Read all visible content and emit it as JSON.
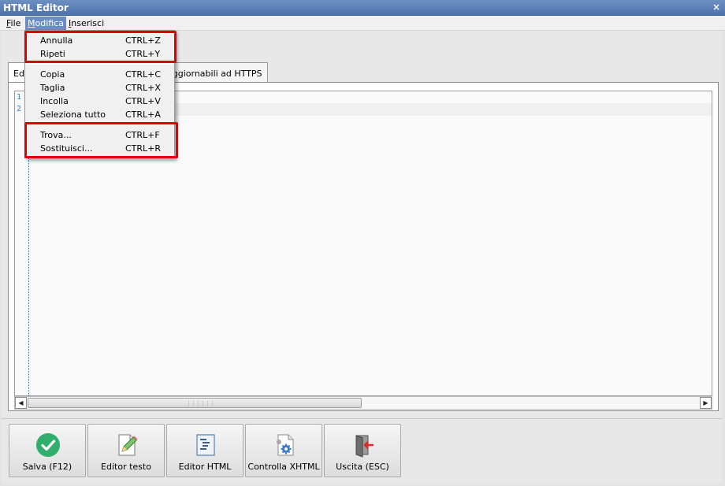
{
  "window": {
    "title": "HTML Editor",
    "close_glyph": "×"
  },
  "menubar": {
    "file": {
      "accel": "F",
      "rest": "ile"
    },
    "modifica": {
      "accel": "M",
      "rest": "odifica"
    },
    "inserisci": {
      "accel": "I",
      "rest": "nserisci"
    }
  },
  "tabs": {
    "first_partial": "Ed",
    "https": "aggiornabili ad HTTPS"
  },
  "editor": {
    "line_numbers": [
      "1",
      "2"
    ]
  },
  "menu_modifica": {
    "items": [
      {
        "label": "Annulla",
        "shortcut": "CTRL+Z"
      },
      {
        "label": "Ripeti",
        "shortcut": "CTRL+Y"
      },
      {
        "label": "Copia",
        "shortcut": "CTRL+C"
      },
      {
        "label": "Taglia",
        "shortcut": "CTRL+X"
      },
      {
        "label": "Incolla",
        "shortcut": "CTRL+V"
      },
      {
        "label": "Seleziona tutto",
        "shortcut": "CTRL+A"
      },
      {
        "label": "Trova...",
        "shortcut": "CTRL+F"
      },
      {
        "label": "Sostituisci...",
        "shortcut": "CTRL+R"
      }
    ]
  },
  "toolbar": {
    "salva": "Salva (F12)",
    "editor_testo": "Editor testo",
    "editor_html": "Editor HTML",
    "controlla_xhtml": "Controlla XHTML",
    "uscita": "Uscita (ESC)"
  },
  "icons": {
    "save": "check-circle-icon",
    "text_editor": "pencil-document-icon",
    "html_editor": "code-document-icon",
    "check_xhtml": "gear-document-icon",
    "exit": "door-exit-icon"
  },
  "colors": {
    "accent": "#6a8dc4",
    "highlight_box": "#e00000",
    "save_green": "#2fae6c"
  }
}
